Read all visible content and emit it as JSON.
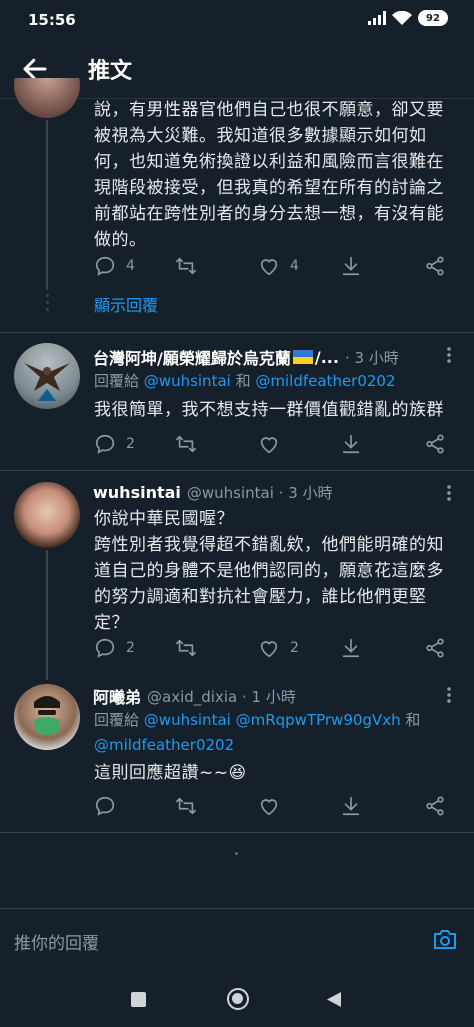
{
  "status": {
    "time": "15:56",
    "battery": "92"
  },
  "header": {
    "title": "推文"
  },
  "tweet1": {
    "lines": [
      "說，有男性器官他們自己也很不願意，卻又要",
      "被視為大災難。我知道很多數據顯示如何如",
      "何，也知道免術換證以利益和風險而言很難在",
      "現階段被接受，但我真的希望在所有的討論之",
      "前都站在跨性別者的身分去想一想，有沒有能",
      "做的。"
    ],
    "reply_count": "4",
    "like_count": "4",
    "show_replies": "顯示回覆"
  },
  "tweet2": {
    "name": "台灣阿坤/願榮耀歸於烏克蘭",
    "name_tail": "/...",
    "time": "· 3 小時",
    "reply_prefix": "回覆給",
    "mention1": "@wuhsintai",
    "and": "和",
    "mention2": "@mildfeather0202",
    "text": "我很簡單，我不想支持一群價值觀錯亂的族群",
    "reply_count": "2"
  },
  "tweet3": {
    "name": "wuhsintai",
    "handle": "@wuhsintai · 3 小時",
    "lines": [
      "你說中華民國喔？",
      "跨性別者我覺得超不錯亂欸，他們能明確的知",
      "道自己的身體不是他們認同的，願意花這麼多",
      "的努力調適和對抗社會壓力，誰比他們更堅",
      "定？"
    ],
    "reply_count": "2",
    "like_count": "2"
  },
  "tweet4": {
    "name": "阿曦弟",
    "handle": "@axid_dixia · 1 小時",
    "reply_prefix": "回覆給",
    "mention1": "@wuhsintai",
    "mention2": "@mRqpwTPrw90gVxh",
    "and": "和",
    "mention3": "@mildfeather0202",
    "text": "這則回應超讚~~😆"
  },
  "reply_bar": {
    "placeholder": "推你的回覆"
  },
  "icons": [
    "back-arrow-icon",
    "reply-icon",
    "retweet-icon",
    "like-icon",
    "download-icon",
    "share-icon",
    "more-icon",
    "camera-icon",
    "signal-icon",
    "wifi-icon"
  ],
  "colors": {
    "background": "#15202b",
    "accent": "#1d9bf0",
    "muted": "#8b98a5",
    "divider": "#38444d"
  }
}
